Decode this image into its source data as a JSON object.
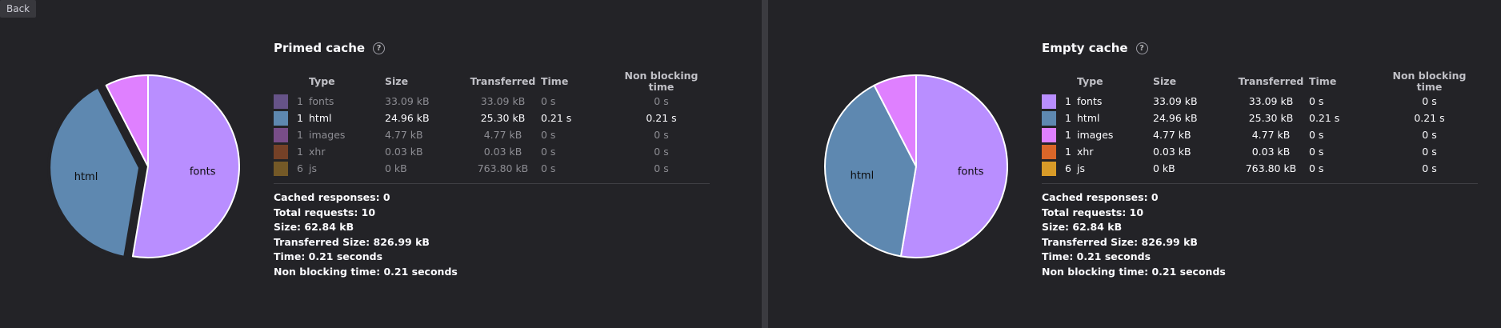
{
  "back_label": "Back",
  "help_glyph": "?",
  "primed": {
    "title": "Primed cache",
    "headers": {
      "type": "Type",
      "size": "Size",
      "transferred": "Transferred",
      "time": "Time",
      "non_blocking": "Non blocking time"
    },
    "rows": [
      {
        "count": "1",
        "type": "fonts",
        "size": "33.09 kB",
        "transferred": "33.09 kB",
        "time": "0 s",
        "non_blocking": "0 s",
        "color": "#b98eff",
        "state": "dim"
      },
      {
        "count": "1",
        "type": "html",
        "size": "24.96 kB",
        "transferred": "25.30 kB",
        "time": "0.21 s",
        "non_blocking": "0.21 s",
        "color": "#5e88b0",
        "state": "bright"
      },
      {
        "count": "1",
        "type": "images",
        "size": "4.77 kB",
        "transferred": "4.77 kB",
        "time": "0 s",
        "non_blocking": "0 s",
        "color": "#df80ff",
        "state": "dim"
      },
      {
        "count": "1",
        "type": "xhr",
        "size": "0.03 kB",
        "transferred": "0.03 kB",
        "time": "0 s",
        "non_blocking": "0 s",
        "color": "#d96629",
        "state": "dim"
      },
      {
        "count": "6",
        "type": "js",
        "size": "0 kB",
        "transferred": "763.80 kB",
        "time": "0 s",
        "non_blocking": "0 s",
        "color": "#d89b28",
        "state": "dim"
      }
    ],
    "summary": {
      "cached": "Cached responses: 0",
      "total": "Total requests: 10",
      "size": "Size: 62.84 kB",
      "transferred": "Transferred Size: 826.99 kB",
      "time": "Time: 0.21 seconds",
      "non_blocking": "Non blocking time: 0.21 seconds"
    },
    "chart_data": {
      "type": "pie",
      "slices": [
        {
          "label": "fonts",
          "value": 33.09,
          "color": "#b98eff",
          "labeled": true
        },
        {
          "label": "html",
          "value": 24.96,
          "color": "#5e88b0",
          "labeled": true
        },
        {
          "label": "images",
          "value": 4.77,
          "color": "#df80ff",
          "labeled": false
        }
      ],
      "highlighted": "html"
    }
  },
  "empty": {
    "title": "Empty cache",
    "headers": {
      "type": "Type",
      "size": "Size",
      "transferred": "Transferred",
      "time": "Time",
      "non_blocking": "Non blocking time"
    },
    "rows": [
      {
        "count": "1",
        "type": "fonts",
        "size": "33.09 kB",
        "transferred": "33.09 kB",
        "time": "0 s",
        "non_blocking": "0 s",
        "color": "#b98eff",
        "state": "bright"
      },
      {
        "count": "1",
        "type": "html",
        "size": "24.96 kB",
        "transferred": "25.30 kB",
        "time": "0.21 s",
        "non_blocking": "0.21 s",
        "color": "#5e88b0",
        "state": "bright"
      },
      {
        "count": "1",
        "type": "images",
        "size": "4.77 kB",
        "transferred": "4.77 kB",
        "time": "0 s",
        "non_blocking": "0 s",
        "color": "#df80ff",
        "state": "bright"
      },
      {
        "count": "1",
        "type": "xhr",
        "size": "0.03 kB",
        "transferred": "0.03 kB",
        "time": "0 s",
        "non_blocking": "0 s",
        "color": "#d96629",
        "state": "bright"
      },
      {
        "count": "6",
        "type": "js",
        "size": "0 kB",
        "transferred": "763.80 kB",
        "time": "0 s",
        "non_blocking": "0 s",
        "color": "#d89b28",
        "state": "bright"
      }
    ],
    "summary": {
      "cached": "Cached responses: 0",
      "total": "Total requests: 10",
      "size": "Size: 62.84 kB",
      "transferred": "Transferred Size: 826.99 kB",
      "time": "Time: 0.21 seconds",
      "non_blocking": "Non blocking time: 0.21 seconds"
    },
    "chart_data": {
      "type": "pie",
      "slices": [
        {
          "label": "fonts",
          "value": 33.09,
          "color": "#b98eff",
          "labeled": true
        },
        {
          "label": "html",
          "value": 24.96,
          "color": "#5e88b0",
          "labeled": true
        },
        {
          "label": "images",
          "value": 4.77,
          "color": "#df80ff",
          "labeled": false
        }
      ],
      "highlighted": null
    }
  }
}
